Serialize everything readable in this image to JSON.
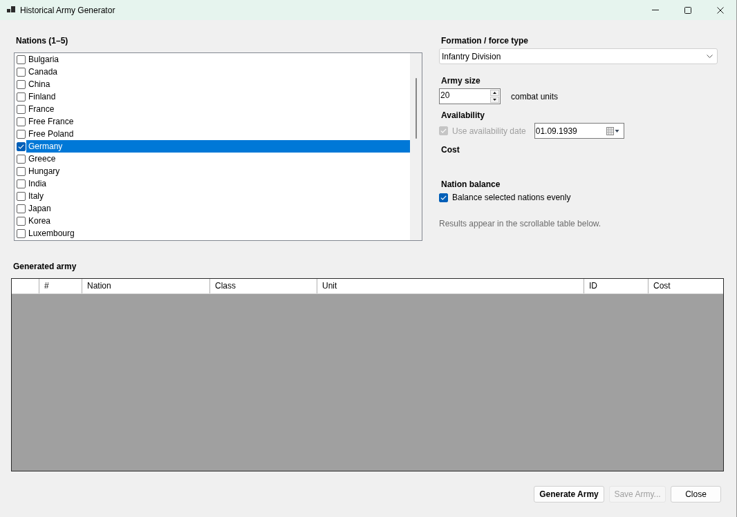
{
  "window": {
    "title": "Historical Army Generator"
  },
  "nations": {
    "label": "Nations (1–5)",
    "items": [
      {
        "name": "Bulgaria",
        "checked": false,
        "selected": false
      },
      {
        "name": "Canada",
        "checked": false,
        "selected": false
      },
      {
        "name": "China",
        "checked": false,
        "selected": false
      },
      {
        "name": "Finland",
        "checked": false,
        "selected": false
      },
      {
        "name": "France",
        "checked": false,
        "selected": false
      },
      {
        "name": "Free France",
        "checked": false,
        "selected": false
      },
      {
        "name": "Free Poland",
        "checked": false,
        "selected": false
      },
      {
        "name": "Germany",
        "checked": true,
        "selected": true
      },
      {
        "name": "Greece",
        "checked": false,
        "selected": false
      },
      {
        "name": "Hungary",
        "checked": false,
        "selected": false
      },
      {
        "name": "India",
        "checked": false,
        "selected": false
      },
      {
        "name": "Italy",
        "checked": false,
        "selected": false
      },
      {
        "name": "Japan",
        "checked": false,
        "selected": false
      },
      {
        "name": "Korea",
        "checked": false,
        "selected": false
      },
      {
        "name": "Luxembourg",
        "checked": false,
        "selected": false
      }
    ]
  },
  "formation": {
    "label": "Formation / force type",
    "value": "Infantry Division"
  },
  "army_size": {
    "label": "Army size",
    "value": "20",
    "unit": "combat units"
  },
  "availability": {
    "label": "Availability",
    "checkbox": {
      "label": "Use availability date",
      "checked": true,
      "disabled": true
    },
    "date": "01.09.1939"
  },
  "cost": {
    "label": "Cost"
  },
  "nation_balance": {
    "label": "Nation balance",
    "checkbox": {
      "label": "Balance selected nations evenly",
      "checked": true,
      "disabled": false
    }
  },
  "hint": "Results appear in the scrollable table below.",
  "table": {
    "label": "Generated army",
    "columns": [
      "#",
      "Nation",
      "Class",
      "Unit",
      "ID",
      "Cost"
    ]
  },
  "buttons": [
    {
      "label": "Generate Army",
      "default": true,
      "disabled": false
    },
    {
      "label": "Save Army...",
      "default": false,
      "disabled": true
    },
    {
      "label": "Close",
      "default": false,
      "disabled": false
    }
  ]
}
